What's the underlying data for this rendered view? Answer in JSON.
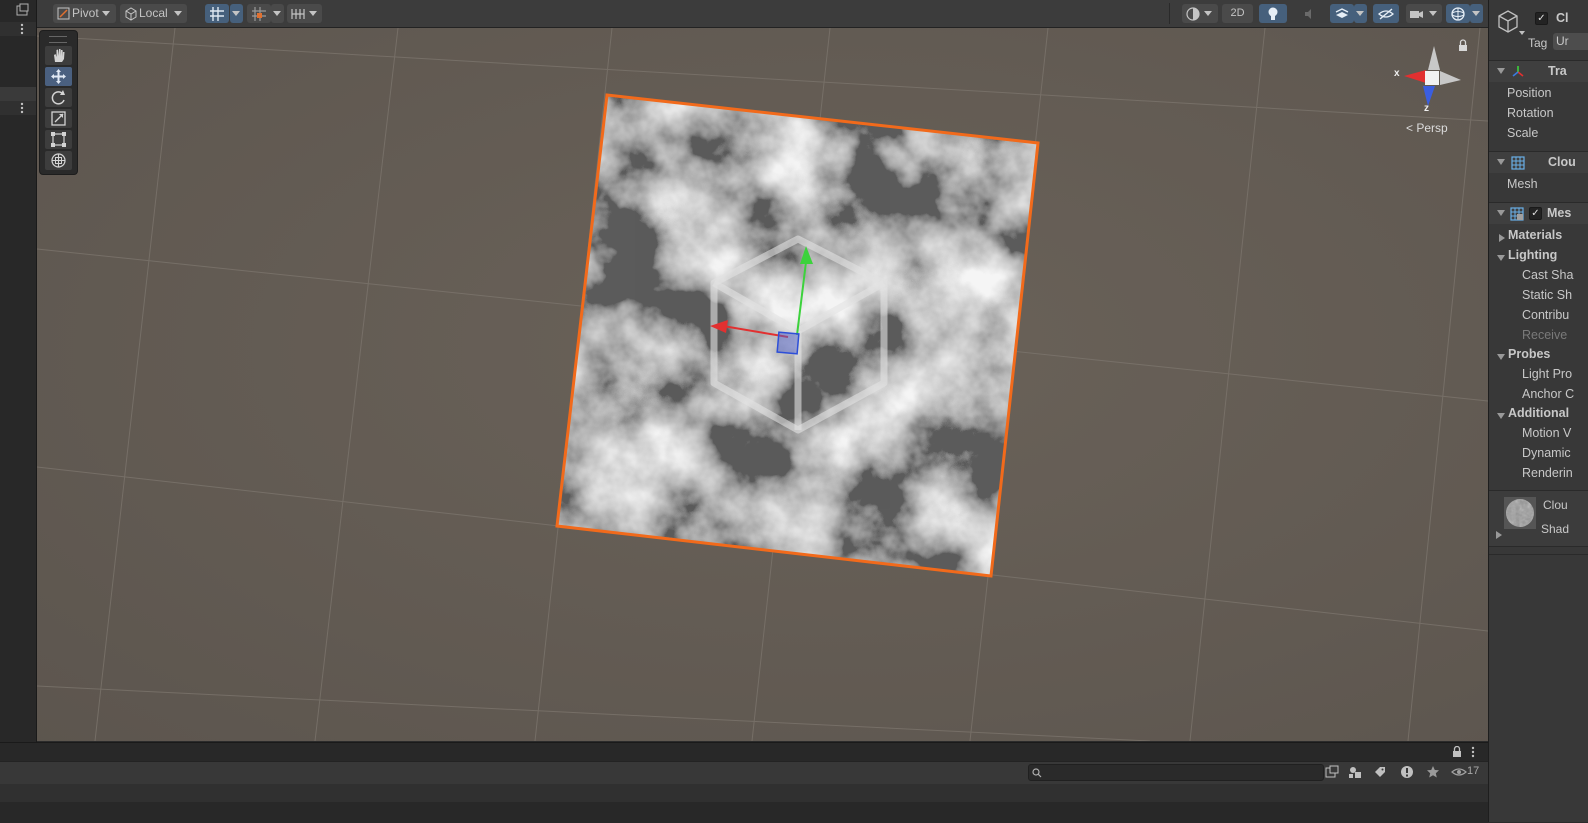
{
  "toolbar": {
    "pivot_label": "Pivot",
    "local_label": "Local",
    "mode_2d_label": "2D"
  },
  "viewport": {
    "projection_label": "Persp",
    "gizmo_axes": {
      "x": "x",
      "z": "z"
    }
  },
  "inspector": {
    "tag_label": "Tag",
    "tag_value": "Ur",
    "name_value": "Cl",
    "components": {
      "transform": "Tra",
      "mesh_filter": "Clou",
      "mesh_renderer": "Mes"
    },
    "transform_props": [
      "Position",
      "Rotation",
      "Scale"
    ],
    "mesh_label": "Mesh",
    "sections": {
      "materials": "Materials",
      "lighting": "Lighting",
      "probes": "Probes",
      "additional": "Additional"
    },
    "lighting_props": [
      "Cast Sha",
      "Static Sh",
      "Contribu",
      "Receive"
    ],
    "probes_props": [
      "Light Pro",
      "Anchor C"
    ],
    "additional_props": [
      "Motion V",
      "Dynamic",
      "Renderin"
    ],
    "material": {
      "name": "Clou",
      "shader": "Shad"
    }
  },
  "bottom": {
    "visible_count": "17"
  },
  "colors": {
    "selection_outline": "#f26a1b",
    "viewport_bg": "#645c54",
    "x_axis": "#e23030",
    "y_axis": "#3cd23c",
    "z_axis": "#2d4fd8",
    "active_button": "#46607c"
  },
  "icons": [
    "maximize-icon",
    "more-icon",
    "pivot-icon",
    "local-cube-icon",
    "grid-snap-icon",
    "snap-increment-icon",
    "ruler-icon",
    "shading-mode-icon",
    "lighting-icon",
    "audio-icon",
    "effects-icon",
    "hidden-objects-icon",
    "camera-icon",
    "gizmos-icon",
    "hand-tool-icon",
    "move-tool-icon",
    "rotate-tool-icon",
    "scale-tool-icon",
    "rect-tool-icon",
    "transform-tool-icon",
    "orientation-gizmo-icon",
    "lock-icon",
    "gameobject-cube-icon",
    "transform-icon",
    "mesh-filter-icon",
    "mesh-renderer-icon",
    "search-icon",
    "filter-type-icon",
    "label-icon",
    "info-icon",
    "star-icon",
    "eye-icon"
  ]
}
